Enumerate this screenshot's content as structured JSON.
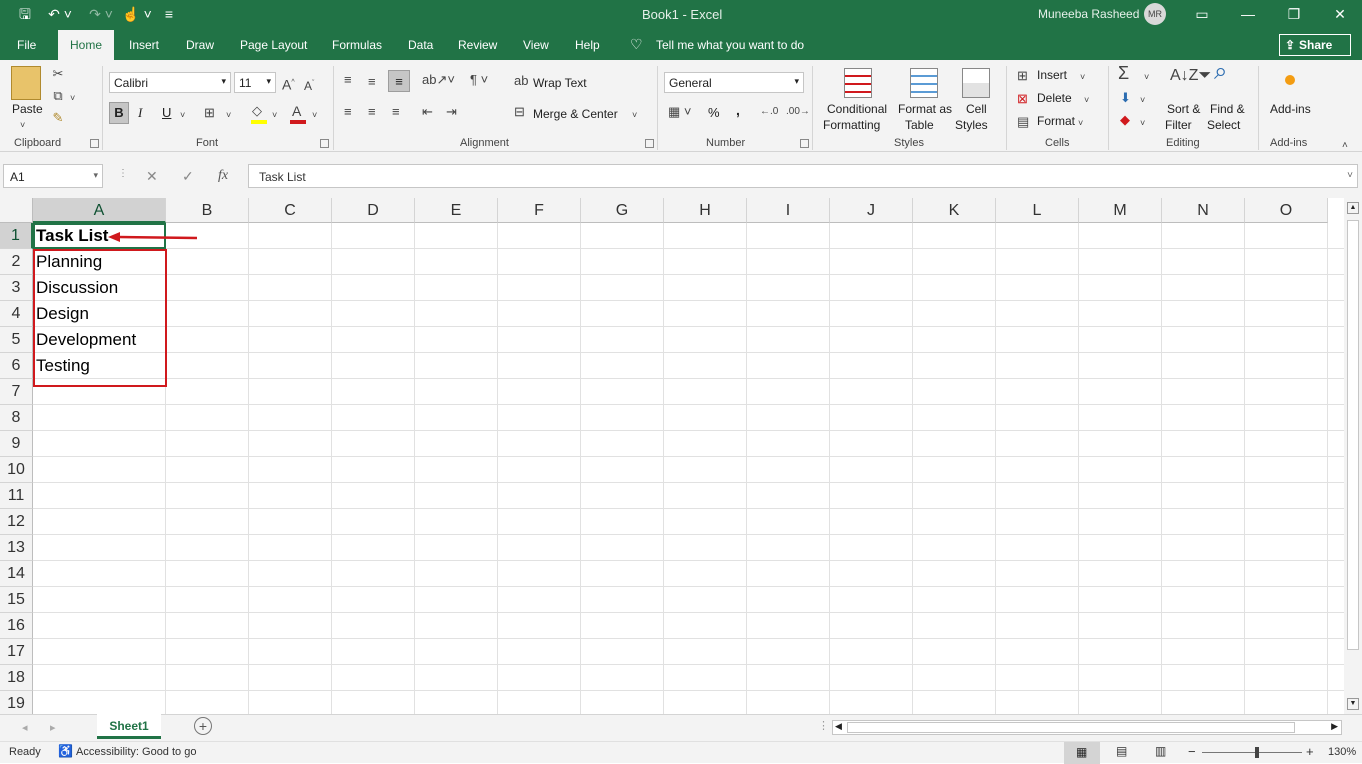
{
  "titlebar": {
    "title": "Book1  -  Excel",
    "user": "Muneeba Rasheed",
    "initials": "MR"
  },
  "menu": {
    "items": [
      "File",
      "Home",
      "Insert",
      "Draw",
      "Page Layout",
      "Formulas",
      "Data",
      "Review",
      "View",
      "Help"
    ],
    "tell_me": "Tell me what you want to do",
    "share": "Share"
  },
  "ribbon": {
    "clipboard": {
      "paste": "Paste",
      "label": "Clipboard"
    },
    "font": {
      "name": "Calibri",
      "size": "11",
      "bold": "B",
      "italic": "I",
      "underline": "U",
      "label": "Font"
    },
    "alignment": {
      "wrap": "Wrap Text",
      "merge": "Merge & Center",
      "label": "Alignment"
    },
    "number": {
      "format": "General",
      "percent": "%",
      "comma": ",",
      "label": "Number"
    },
    "styles": {
      "cond1": "Conditional",
      "cond2": "Formatting",
      "fmt1": "Format as",
      "fmt2": "Table",
      "cell1": "Cell",
      "cell2": "Styles",
      "label": "Styles"
    },
    "cells": {
      "insert": "Insert",
      "delete": "Delete",
      "format": "Format",
      "label": "Cells"
    },
    "editing": {
      "sort1": "Sort &",
      "sort2": "Filter",
      "find1": "Find &",
      "find2": "Select",
      "label": "Editing"
    },
    "addins": {
      "label1": "Add-ins",
      "label": "Add-ins"
    }
  },
  "formula_bar": {
    "name_box": "A1",
    "fx": "fx",
    "content": "Task List"
  },
  "sheet": {
    "columns": [
      "A",
      "B",
      "C",
      "D",
      "E",
      "F",
      "G",
      "H",
      "I",
      "J",
      "K",
      "L",
      "M",
      "N",
      "O"
    ],
    "rows": [
      "1",
      "2",
      "3",
      "4",
      "5",
      "6",
      "7",
      "8",
      "9",
      "10",
      "11",
      "12",
      "13",
      "14",
      "15",
      "16",
      "17",
      "18",
      "19"
    ],
    "cells": {
      "A1": "Task List",
      "A2": "Planning",
      "A3": "Discussion",
      "A4": "Design",
      "A5": "Development",
      "A6": "Testing"
    }
  },
  "tabs": {
    "sheet1": "Sheet1"
  },
  "status": {
    "ready": "Ready",
    "accessibility": "Accessibility: Good to go",
    "zoom": "130%"
  },
  "colors": {
    "excel_green": "#217346",
    "annotation_red": "#d0191d"
  }
}
